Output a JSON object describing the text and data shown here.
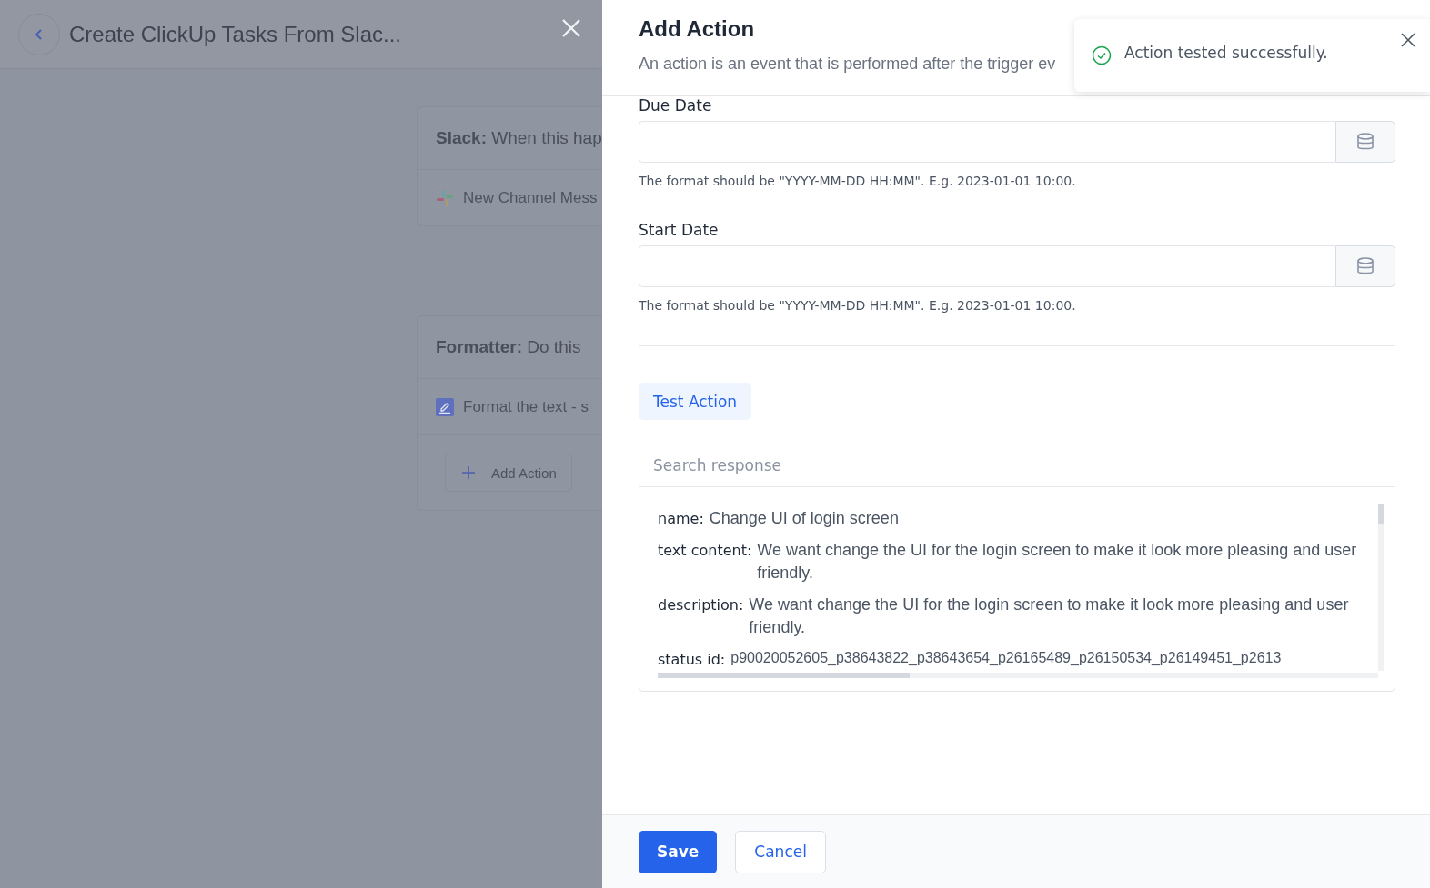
{
  "background": {
    "title": "Create ClickUp Tasks From Slac...",
    "steps": [
      {
        "kind": "trigger",
        "app": "Slack:",
        "caption": "When this hap",
        "item": "New Channel Mess"
      },
      {
        "kind": "action",
        "app": "Formatter:",
        "caption": "Do this",
        "item": "Format the text - s",
        "add_button": "Add Action"
      }
    ]
  },
  "panel": {
    "title": "Add Action",
    "description": "An action is an event that is performed after the trigger ev",
    "fields": [
      {
        "label": "Due Date",
        "hint": "The format should be \"YYYY-MM-DD HH:MM\". E.g. 2023-01-01 10:00."
      },
      {
        "label": "Start Date",
        "hint": "The format should be \"YYYY-MM-DD HH:MM\". E.g. 2023-01-01 10:00."
      }
    ],
    "test_button": "Test Action",
    "response": {
      "placeholder": "Search response",
      "entries": [
        {
          "key": "name:",
          "value": "Change UI of login screen"
        },
        {
          "key": "text content:",
          "value": "We want change the UI for the login screen to make it look more pleasing and user friendly."
        },
        {
          "key": "description:",
          "value": "We want change the UI for the login screen to make it look more pleasing and user friendly."
        },
        {
          "key": "status id:",
          "value": "p90020052605_p38643822_p38643654_p26165489_p26150534_p26149451_p2613"
        }
      ]
    },
    "buttons": [
      {
        "label": "Save",
        "kind": "primary"
      },
      {
        "label": "Cancel",
        "kind": "secondary"
      }
    ]
  },
  "toast": {
    "message": "Action tested successfully."
  }
}
